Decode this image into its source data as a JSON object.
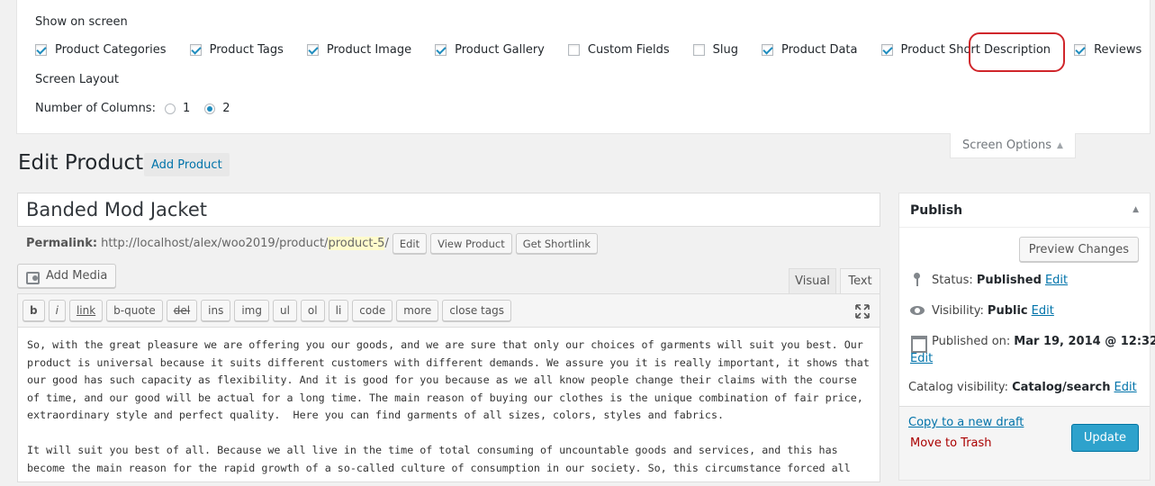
{
  "screen_options": {
    "show_heading": "Show on screen",
    "checkboxes": [
      {
        "label": "Product Categories",
        "checked": true
      },
      {
        "label": "Product Tags",
        "checked": true
      },
      {
        "label": "Product Image",
        "checked": true
      },
      {
        "label": "Product Gallery",
        "checked": true
      },
      {
        "label": "Custom Fields",
        "checked": false
      },
      {
        "label": "Slug",
        "checked": false
      },
      {
        "label": "Product Data",
        "checked": true
      },
      {
        "label": "Product Short Description",
        "checked": true
      },
      {
        "label": "Reviews",
        "checked": true
      }
    ],
    "layout_heading": "Screen Layout",
    "columns_label": "Number of Columns:",
    "column_options": [
      "1",
      "2"
    ],
    "selected_columns": "2",
    "tab_label": "Screen Options"
  },
  "page": {
    "title": "Edit Product",
    "add_new": "Add Product"
  },
  "post": {
    "title": "Banded Mod Jacket",
    "permalink_label": "Permalink:",
    "permalink_base": "http://localhost/alex/woo2019/product/",
    "permalink_slug": "product-5",
    "permalink_end": "/",
    "edit_btn": "Edit",
    "view_btn": "View Product",
    "shortlink_btn": "Get Shortlink"
  },
  "editor": {
    "add_media": "Add Media",
    "tab_visual": "Visual",
    "tab_text": "Text",
    "quicktags": [
      "b",
      "i",
      "link",
      "b-quote",
      "del",
      "ins",
      "img",
      "ul",
      "ol",
      "li",
      "code",
      "more",
      "close tags"
    ],
    "content": "So, with the great pleasure we are offering you our goods, and we are sure that only our choices of garments will suit you best. Our product is universal because it suits different customers with different demands. We assure you it is really important, it shows that our good has such capacity as flexibility. And it is good for you because as we all know people change their claims with the course of time, and our good will be actual for a long time. The main reason of buying our clothes is the unique combination of fair price, extraordinary style and perfect quality.  Here you can find garments of all sizes, colors, styles and fabrics.\n\nIt will suit you best of all. Because we all live in the time of total consuming of uncountable goods and services, and this has become the main reason for the rapid growth of a so-called culture of consumption in our society. So, this circumstance forced all"
  },
  "publish": {
    "title": "Publish",
    "preview": "Preview Changes",
    "status_label": "Status:",
    "status_value": "Published",
    "visibility_label": "Visibility:",
    "visibility_value": "Public",
    "published_label": "Published on:",
    "published_value": "Mar 19, 2014 @ 12:32",
    "catalog_label": "Catalog visibility:",
    "catalog_value": "Catalog/search",
    "edit": "Edit",
    "copy_draft": "Copy to a new draft",
    "trash": "Move to Trash",
    "update": "Update"
  }
}
